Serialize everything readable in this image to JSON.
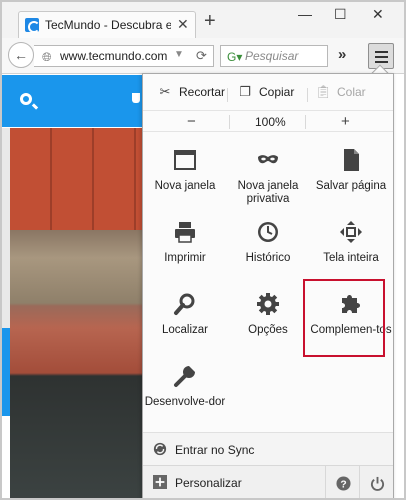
{
  "browser": {
    "tab_title": "TecMundo - Descubra e a...",
    "url": "www.tecmundo.com",
    "search_placeholder": "Pesquisar"
  },
  "menu": {
    "edit": {
      "cut": "Recortar",
      "copy": "Copiar",
      "paste": "Colar"
    },
    "zoom": {
      "minus": "−",
      "value": "100%",
      "plus": "+"
    },
    "items": [
      {
        "label": "Nova janela",
        "icon": "new-window-icon"
      },
      {
        "label": "Nova janela privativa",
        "icon": "private-mask-icon"
      },
      {
        "label": "Salvar página",
        "icon": "save-page-icon"
      },
      {
        "label": "Imprimir",
        "icon": "printer-icon"
      },
      {
        "label": "Histórico",
        "icon": "history-clock-icon"
      },
      {
        "label": "Tela inteira",
        "icon": "fullscreen-icon"
      },
      {
        "label": "Localizar",
        "icon": "find-magnifier-icon"
      },
      {
        "label": "Opções",
        "icon": "options-gear-icon"
      },
      {
        "label": "Complemen-tos",
        "icon": "addons-puzzle-icon"
      },
      {
        "label": "Desenvolve-dor",
        "icon": "developer-wrench-icon"
      }
    ],
    "sync_label": "Entrar no Sync",
    "customize_label": "Personalizar"
  },
  "colors": {
    "highlight": "#c8102e",
    "page_header": "#1a96ec"
  }
}
